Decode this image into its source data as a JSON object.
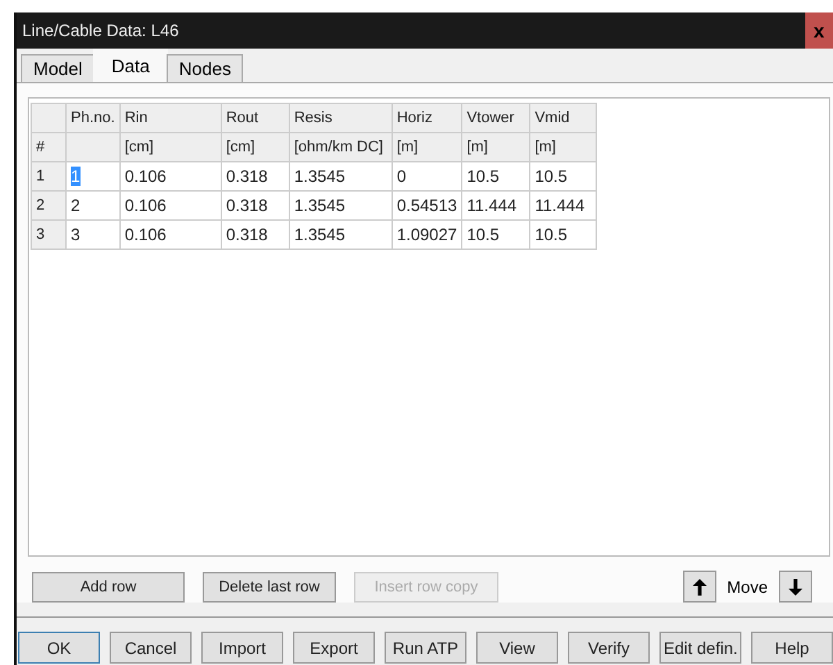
{
  "window": {
    "title": "Line/Cable Data: L46",
    "close": "x"
  },
  "tabs": [
    {
      "label": "Model",
      "selected": false
    },
    {
      "label": "Data",
      "selected": true
    },
    {
      "label": "Nodes",
      "selected": false
    }
  ],
  "table": {
    "header_rows": [
      [
        "",
        "Ph.no.",
        "Rin",
        "Rout",
        "Resis",
        "Horiz",
        "Vtower",
        "Vmid"
      ],
      [
        "#",
        "",
        "[cm]",
        "[cm]",
        "[ohm/km DC]",
        "[m]",
        "[m]",
        "[m]"
      ]
    ],
    "rows": [
      {
        "index": "1",
        "cells": [
          "1",
          "0.106",
          "0.318",
          "1.3545",
          "0",
          "10.5",
          "10.5"
        ],
        "selected": true
      },
      {
        "index": "2",
        "cells": [
          "2",
          "0.106",
          "0.318",
          "1.3545",
          "0.54513",
          "11.444",
          "11.444"
        ],
        "selected": false
      },
      {
        "index": "3",
        "cells": [
          "3",
          "0.106",
          "0.318",
          "1.3545",
          "1.09027",
          "10.5",
          "10.5"
        ],
        "selected": false
      }
    ]
  },
  "row_buttons": [
    {
      "label": "Add row",
      "disabled": false
    },
    {
      "label": "Delete last row",
      "disabled": false
    },
    {
      "label": "Insert row copy",
      "disabled": true
    }
  ],
  "move": {
    "label": "Move"
  },
  "buttons": [
    {
      "label": "OK",
      "default": true
    },
    {
      "label": "Cancel",
      "default": false
    },
    {
      "label": "Import",
      "default": false
    },
    {
      "label": "Export",
      "default": false
    },
    {
      "label": "Run ATP",
      "default": false
    },
    {
      "label": "View",
      "default": false
    },
    {
      "label": "Verify",
      "default": false
    },
    {
      "label": "Edit defin.",
      "default": false
    },
    {
      "label": "Help",
      "default": false
    }
  ]
}
